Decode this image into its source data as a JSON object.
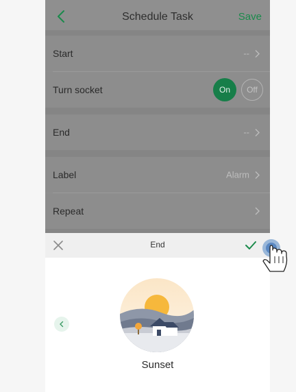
{
  "nav": {
    "back_icon": "chevron-left-icon",
    "title": "Schedule Task",
    "save_label": "Save"
  },
  "rows": {
    "start": {
      "label": "Start",
      "value": "--"
    },
    "turn_socket": {
      "label": "Turn socket",
      "on_label": "On",
      "off_label": "Off",
      "selected": "On"
    },
    "end": {
      "label": "End",
      "value": "--"
    },
    "label": {
      "label": "Label",
      "value": "Alarm"
    },
    "repeat": {
      "label": "Repeat"
    }
  },
  "sheet": {
    "close_icon": "close-icon",
    "title": "End",
    "confirm_icon": "checkmark-icon",
    "prev_icon": "chevron-left-icon",
    "scene_label": "Sunset"
  },
  "colors": {
    "accent_green": "#1a8a4b",
    "toggle_on": "#177e49",
    "overlay_gray": "#8f8f8f",
    "sheet_header": "#efefef",
    "sunset_sun": "#f6b83c"
  }
}
